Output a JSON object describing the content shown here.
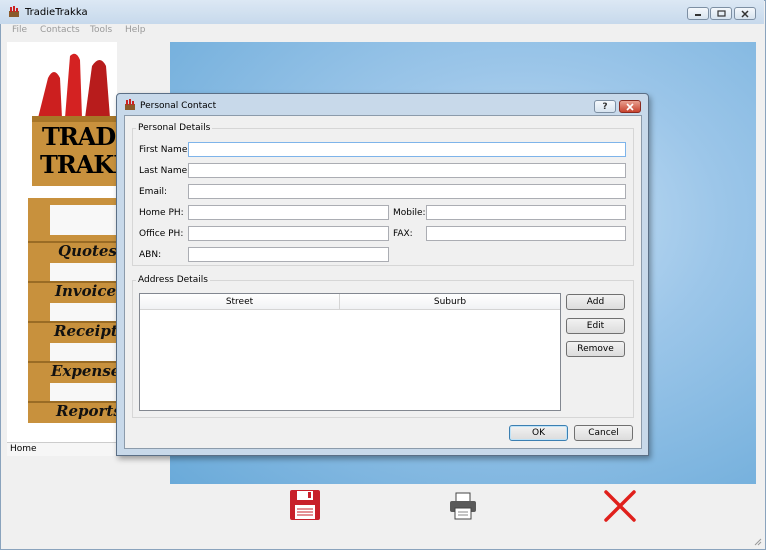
{
  "window": {
    "title": "TradieTrakka"
  },
  "menu": {
    "items": [
      "File",
      "Contacts",
      "Tools",
      "Help"
    ]
  },
  "sidebar": {
    "logo_line1": "TRADIE",
    "logo_line2": "TRAKKA",
    "tabs": [
      "Quotes",
      "Invoices",
      "Receipts",
      "Expenses",
      "Reports"
    ],
    "status": "Home"
  },
  "dialog": {
    "title": "Personal Contact",
    "personal_group": "Personal Details",
    "labels": {
      "first_name": "First Name:",
      "last_name": "Last Name:",
      "email": "Email:",
      "home_ph": "Home PH:",
      "mobile": "Mobile:",
      "office_ph": "Office PH:",
      "fax": "FAX:",
      "abn": "ABN:"
    },
    "values": {
      "first_name": "",
      "last_name": "",
      "email": "",
      "home_ph": "",
      "mobile": "",
      "office_ph": "",
      "fax": "",
      "abn": ""
    },
    "address_group": "Address Details",
    "table_headers": [
      "Street",
      "Suburb"
    ],
    "table_rows": [],
    "buttons": {
      "add": "Add",
      "edit": "Edit",
      "remove": "Remove",
      "ok": "OK",
      "cancel": "Cancel"
    }
  },
  "toolbar": {
    "icons": [
      "save-icon",
      "print-icon",
      "close-icon"
    ]
  },
  "colors": {
    "desktop_blue": "#9cc6e9",
    "close_red": "#e0201c",
    "save_red": "#c8202a"
  }
}
